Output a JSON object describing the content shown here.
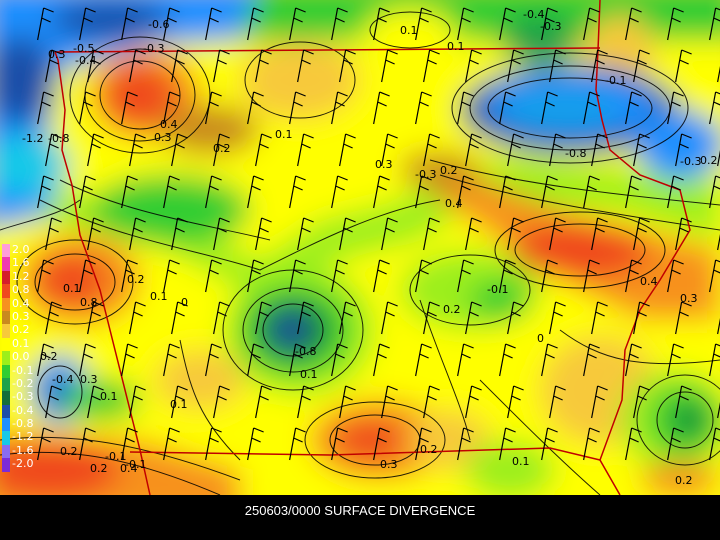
{
  "caption": "250603/0000 SURFACE DIVERGENCE",
  "legend": {
    "levels": [
      {
        "label": "2.0",
        "color": "#ff9ed8"
      },
      {
        "label": "1.6",
        "color": "#f03bb0"
      },
      {
        "label": "1.2",
        "color": "#d51f2a"
      },
      {
        "label": "0.8",
        "color": "#f04a1e"
      },
      {
        "label": "0.4",
        "color": "#f7911f"
      },
      {
        "label": "0.3",
        "color": "#c98a1e"
      },
      {
        "label": "0.2",
        "color": "#f7c93a"
      },
      {
        "label": "0.1",
        "color": "#ffff00"
      },
      {
        "label": "0.0",
        "color": "#9cef1a"
      },
      {
        "label": "-0.1",
        "color": "#32cd32"
      },
      {
        "label": "-0.2",
        "color": "#1ea24a"
      },
      {
        "label": "-0.3",
        "color": "#146f3a"
      },
      {
        "label": "-0.4",
        "color": "#1c4fa8"
      },
      {
        "label": "-0.8",
        "color": "#1e90ff"
      },
      {
        "label": "-1.2",
        "color": "#18c9e8"
      },
      {
        "label": "-1.6",
        "color": "#8a6cf0"
      },
      {
        "label": "-2.0",
        "color": "#7d2bd6"
      }
    ]
  },
  "contour_labels": [
    "-0.6",
    "-0.5",
    "-0.4",
    "-0.3",
    "0.1",
    "0.1",
    "-0.4",
    "-0.3",
    "-0.1",
    "-1.2",
    "-0.8",
    "0.4",
    "0.3",
    "0.1",
    "0.2",
    "-0.8",
    "-0.3",
    "0.2",
    "0.3",
    "0.4",
    "0.2",
    "0.8",
    "0.1",
    "0",
    "0.2",
    "0.1",
    "0.4",
    "0.3",
    "-0.1",
    "0",
    "-0.8",
    "0.2",
    "0.1",
    "0.1",
    "-0.4",
    "0.3",
    "0.1",
    "0.2",
    "-0.1",
    "0.2",
    "-0.1",
    "0.2",
    "0.3",
    "0.1",
    "0.2",
    "-0.3",
    "0.4",
    "0.2",
    "0.3"
  ]
}
